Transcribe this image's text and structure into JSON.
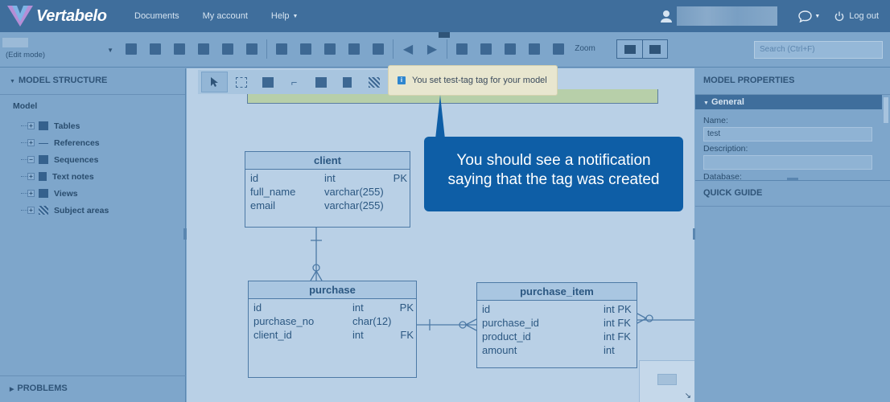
{
  "app": {
    "brand": "Vertabelo"
  },
  "nav": {
    "documents": "Documents",
    "account": "My account",
    "help": "Help"
  },
  "topbar": {
    "logout": "Log out"
  },
  "toolbar": {
    "edit_mode": "(Edit mode)",
    "zoom_label": "Zoom",
    "search_placeholder": "Search (Ctrl+F)"
  },
  "left_panel": {
    "header": "MODEL STRUCTURE",
    "root": "Model",
    "items": [
      {
        "label": "Tables",
        "icon": "table-icon"
      },
      {
        "label": "References",
        "icon": "reference-icon"
      },
      {
        "label": "Sequences",
        "icon": "sequence-icon"
      },
      {
        "label": "Text notes",
        "icon": "note-icon"
      },
      {
        "label": "Views",
        "icon": "view-icon"
      },
      {
        "label": "Subject areas",
        "icon": "subject-area-icon"
      }
    ],
    "problems": "PROBLEMS"
  },
  "notification": {
    "text": "You set test-tag tag for your model"
  },
  "callout": {
    "line1": "You should see a notification",
    "line2": "saying that the tag was created"
  },
  "tables": {
    "client": {
      "name": "client",
      "rows": [
        {
          "col": "id",
          "type": "int",
          "key": "PK"
        },
        {
          "col": "full_name",
          "type": "varchar(255)",
          "key": ""
        },
        {
          "col": "email",
          "type": "varchar(255)",
          "key": ""
        }
      ]
    },
    "purchase": {
      "name": "purchase",
      "rows": [
        {
          "col": "id",
          "type": "int",
          "key": "PK"
        },
        {
          "col": "purchase_no",
          "type": "char(12)",
          "key": ""
        },
        {
          "col": "client_id",
          "type": "int",
          "key": "FK"
        }
      ]
    },
    "purchase_item": {
      "name": "purchase_item",
      "rows": [
        {
          "col": "id",
          "type": "int PK",
          "key": ""
        },
        {
          "col": "purchase_id",
          "type": "int FK",
          "key": ""
        },
        {
          "col": "product_id",
          "type": "int FK",
          "key": ""
        },
        {
          "col": "amount",
          "type": "int",
          "key": ""
        }
      ]
    }
  },
  "right_panel": {
    "header": "MODEL PROPERTIES",
    "general": "General",
    "name_label": "Name:",
    "name_value": "test",
    "description_label": "Description:",
    "description_value": "",
    "database_label": "Database:",
    "quick_guide": "QUICK GUIDE"
  }
}
